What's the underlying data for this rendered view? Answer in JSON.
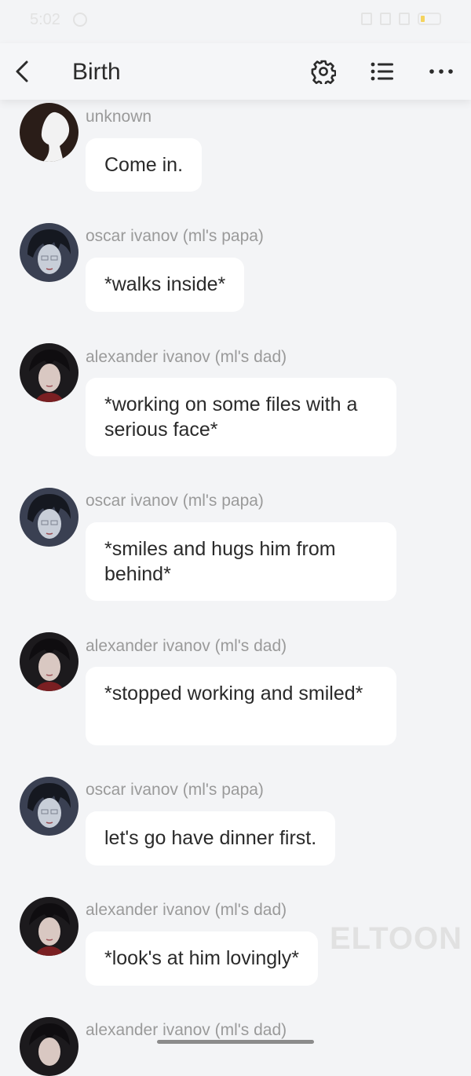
{
  "status_bar": {
    "time": "5:02",
    "icons": [
      "sync-icon",
      "vibrate-icon",
      "signal-icon",
      "signal-icon-2",
      "battery-icon"
    ]
  },
  "header": {
    "title": "Birth",
    "back_icon": "chevron-left-icon",
    "settings_icon": "gear-icon",
    "list_icon": "list-icon",
    "more_icon": "more-dots-icon"
  },
  "messages": [
    {
      "sender": "unknown",
      "text": "Come in.",
      "avatar": "silhouette"
    },
    {
      "sender": "oscar ivanov (ml's papa)",
      "text": "*walks inside*",
      "avatar": "oscar"
    },
    {
      "sender": "alexander ivanov (ml's dad)",
      "text": "*working on some files with a serious face*",
      "avatar": "alexander"
    },
    {
      "sender": "oscar ivanov (ml's papa)",
      "text": "*smiles and hugs him from behind*",
      "avatar": "oscar"
    },
    {
      "sender": "alexander ivanov (ml's dad)",
      "text": "*stopped working and smiled*",
      "avatar": "alexander"
    },
    {
      "sender": "oscar ivanov (ml's papa)",
      "text": "let's go have dinner first.",
      "avatar": "oscar"
    },
    {
      "sender": "alexander ivanov (ml's dad)",
      "text": "*look's at him lovingly*",
      "avatar": "alexander"
    },
    {
      "sender": "alexander ivanov (ml's dad)",
      "text": "",
      "avatar": "alexander"
    }
  ],
  "watermark": "ELTOON",
  "colors": {
    "background": "#f3f4f6",
    "bubble": "#ffffff",
    "name_text": "#9a9a9a",
    "message_text": "#2a2a2a"
  }
}
